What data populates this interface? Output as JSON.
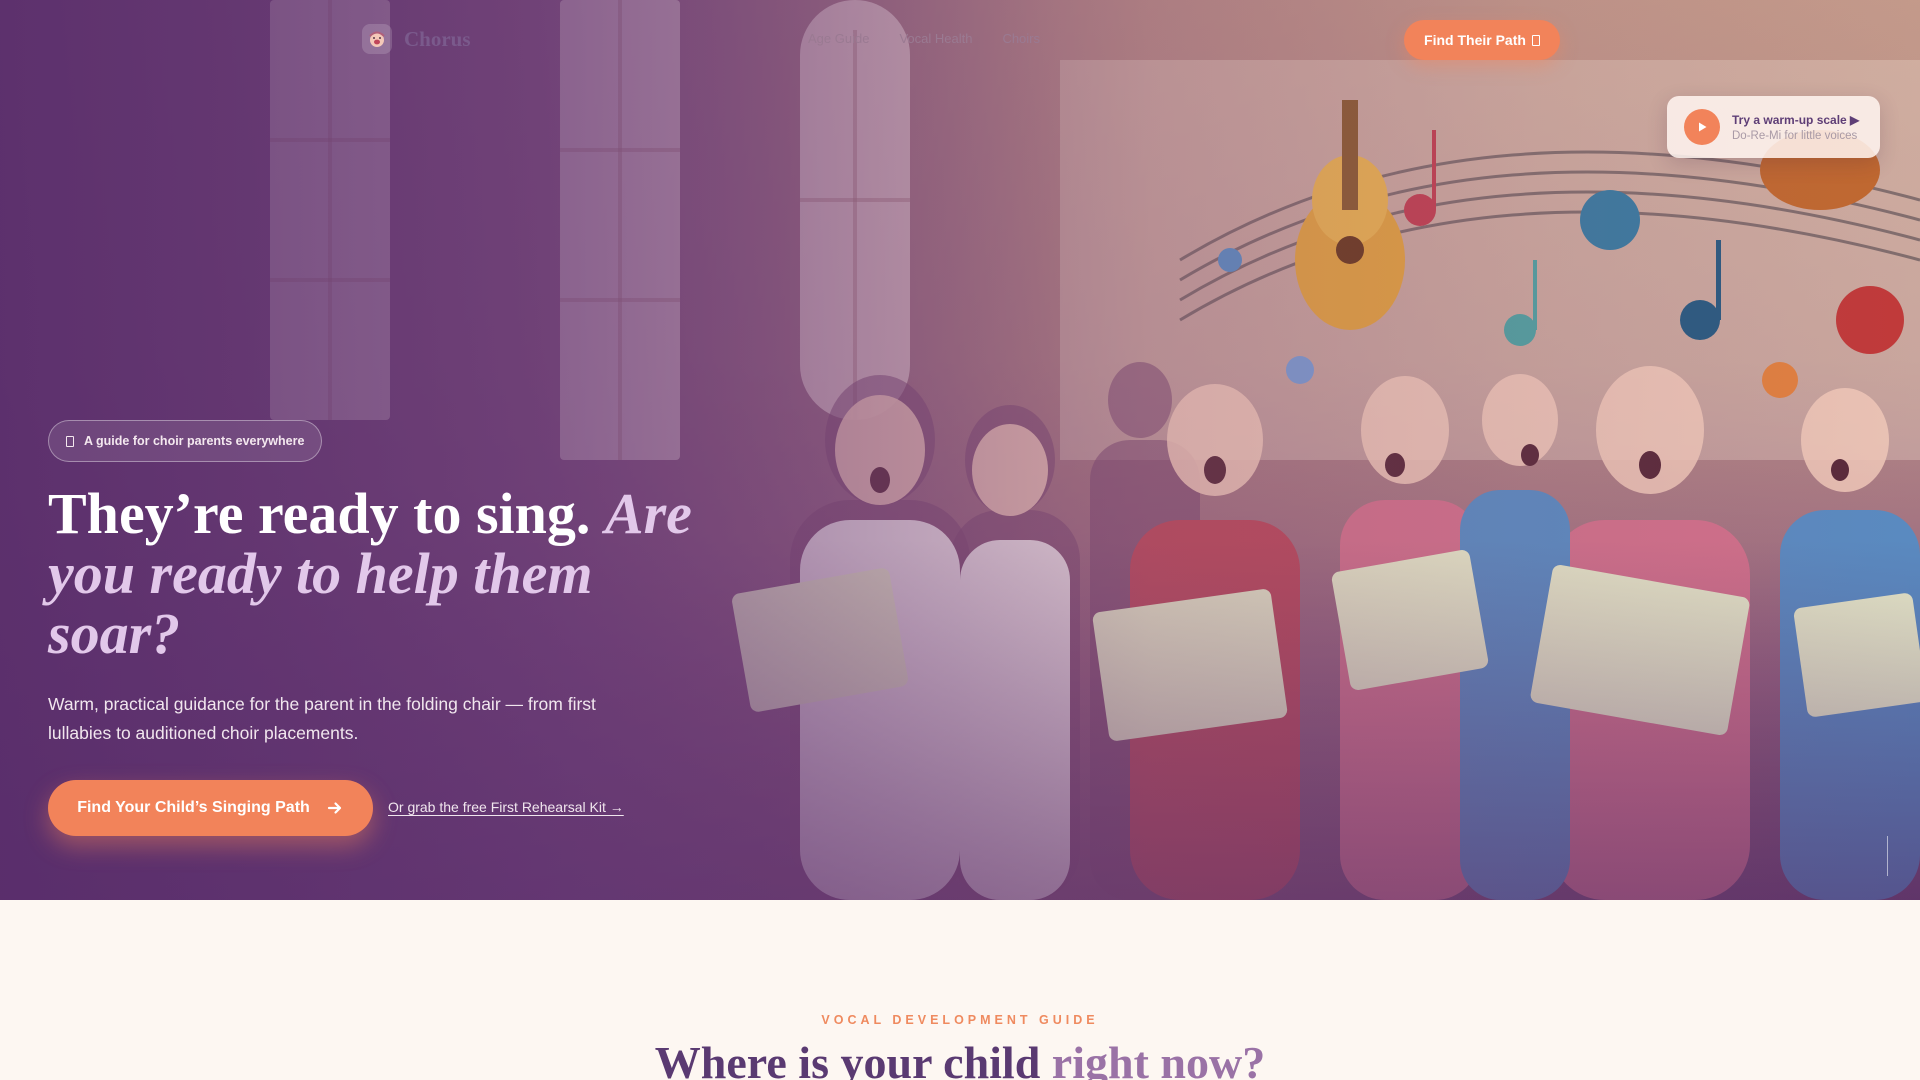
{
  "brand": {
    "name": "Chorus"
  },
  "nav": {
    "links": [
      "Age Guide",
      "Vocal Health",
      "Choirs"
    ],
    "cta_label": "Find Their Path"
  },
  "audio_card": {
    "title": "Try a warm-up scale ▶",
    "subtitle": "Do-Re-Mi for little voices"
  },
  "hero": {
    "badge": "A guide for choir parents everywhere",
    "headline_plain": "They’re ready to sing.",
    "headline_accent": "Are you ready to help them soar?",
    "subcopy": "Warm, practical guidance for the parent in the folding chair — from first lullabies to auditioned choir placements.",
    "primary_cta": "Find Your Child’s Singing Path",
    "secondary_link": "Or grab the free First Rehearsal Kit →"
  },
  "section": {
    "eyebrow": "VOCAL DEVELOPMENT GUIDE",
    "title_plain": "Where is your child",
    "title_accent": "right now?"
  },
  "colors": {
    "accent": "#f2835a",
    "brand_purple": "#5a3a72",
    "page_bg": "#fdf7f2"
  }
}
